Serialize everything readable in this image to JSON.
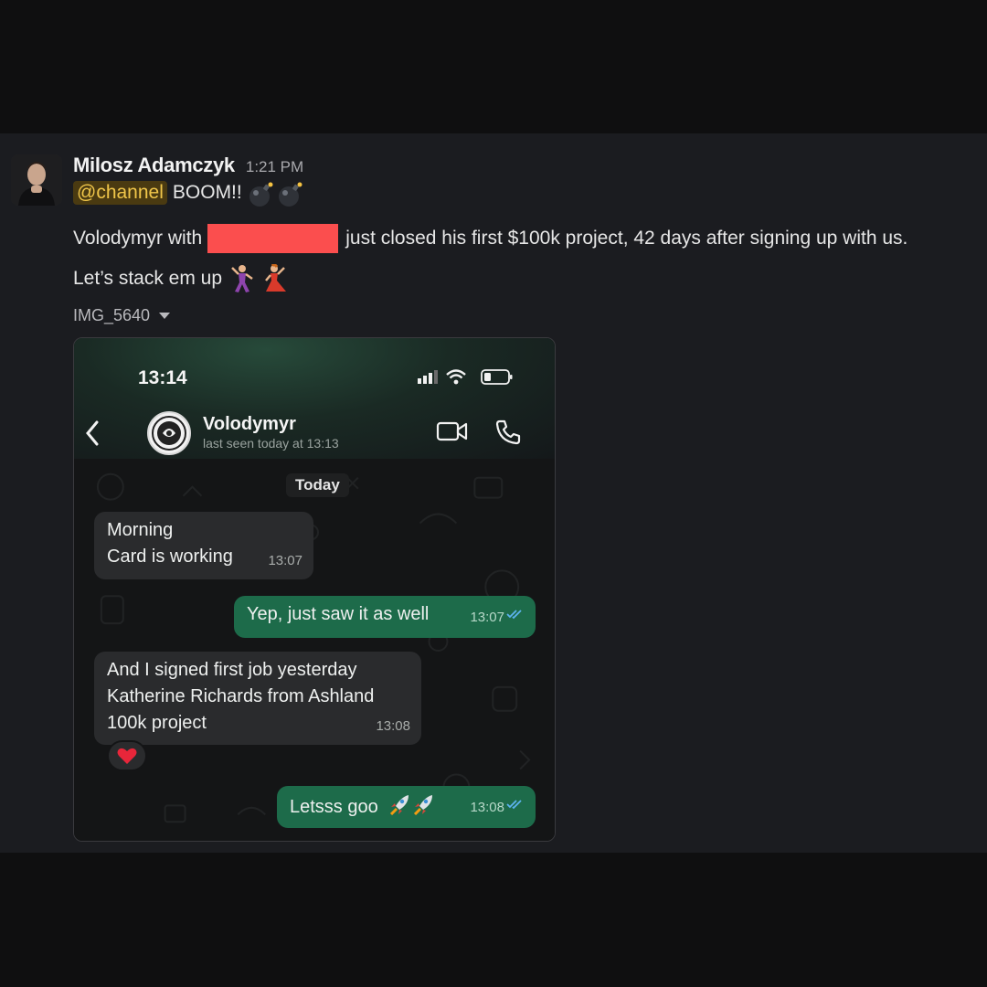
{
  "message": {
    "author": "Milosz Adamczyk",
    "time": "1:21 PM",
    "mention": "@channel",
    "line1_text": "BOOM!!",
    "line2_prefix": "Volodymyr with",
    "line2_suffix": "just closed his first $100k project, 42 days after signing up with us.",
    "line3_text": "Let’s stack em up",
    "file_name": "IMG_5640"
  },
  "phone": {
    "clock": "13:14",
    "contact_name": "Volodymyr",
    "last_seen": "last seen today at 13:13",
    "day_label": "Today",
    "messages": [
      {
        "lines": [
          "Morning",
          "Card is working"
        ],
        "time": "13:07",
        "direction": "in"
      },
      {
        "lines": [
          "Yep, just saw it as well"
        ],
        "time": "13:07",
        "direction": "out"
      },
      {
        "lines": [
          "And I signed first job yesterday",
          "Katherine Richards from Ashland",
          "100k project"
        ],
        "time": "13:08",
        "direction": "in",
        "reaction": "heart"
      },
      {
        "lines": [
          "Letsss goo"
        ],
        "time": "13:08",
        "direction": "out",
        "emoji": "rocket"
      }
    ]
  },
  "colors": {
    "panel_bg": "#1b1c20",
    "mention_bg": "#4a3a11",
    "mention_text": "#f0c64a",
    "redaction": "#fb4e4e",
    "outgoing_bubble": "#1d6b4a",
    "incoming_bubble": "#2a2b2d"
  },
  "icons": [
    "bomb-icon",
    "dancer-icon",
    "caret-down-icon",
    "back-chevron-icon",
    "video-icon",
    "phone-icon",
    "double-check-icon",
    "heart-icon",
    "rocket-icon"
  ]
}
